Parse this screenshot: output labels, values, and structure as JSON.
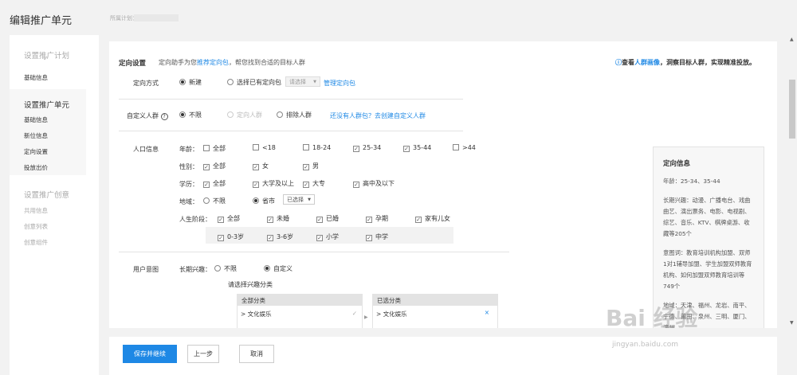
{
  "header": {
    "title": "编辑推广单元",
    "plan_label": "所属计划："
  },
  "sidebar": {
    "step1": {
      "title": "设置推广计划",
      "items": [
        "基础信息"
      ]
    },
    "step2": {
      "title": "设置推广单元",
      "items": [
        "基础信息",
        "新位信息",
        "定向设置",
        "投放出价"
      ]
    },
    "step3": {
      "title": "设置推广创意",
      "items": [
        "共用信息",
        "创意列表",
        "创意组件"
      ]
    }
  },
  "targeting": {
    "section_title": "定向设置",
    "hint_prefix": "定向助手为您",
    "hint_link": "推荐定向包",
    "hint_suffix": "，帮您找到合适的目标人群",
    "right_icon": "ⓘ",
    "right_prefix": "查看",
    "right_link": "人群画像",
    "right_suffix": "，洞察目标人群，实现精准投放。",
    "method": {
      "label": "定向方式",
      "opt_new": "新建",
      "opt_existing": "选择已有定向包",
      "select_placeholder": "请选择",
      "manage_link": "管理定向包"
    },
    "custom": {
      "label": "自定义人群",
      "help_icon": "?",
      "opt_unlimited": "不限",
      "opt_target": "定向人群",
      "opt_exclude": "排除人群",
      "tip_link": "还没有人群包？去创建自定义人群"
    },
    "demographics": {
      "label": "人口信息",
      "age": {
        "label": "年龄：",
        "options": [
          "全部",
          "<18",
          "18-24",
          "25-34",
          "35-44",
          ">44"
        ]
      },
      "gender": {
        "label": "性别：",
        "options": [
          "全部",
          "女",
          "男"
        ]
      },
      "education": {
        "label": "学历：",
        "options": [
          "全部",
          "大学及以上",
          "大专",
          "高中及以下"
        ]
      },
      "region": {
        "label": "地域：",
        "opt_unlimited": "不限",
        "opt_province": "省市",
        "select": "已选择"
      },
      "life_stage": {
        "label": "人生阶段：",
        "options": [
          "全部",
          "未婚",
          "已婚",
          "孕期",
          "家有儿女"
        ],
        "children": [
          "0-3岁",
          "3-6岁",
          "小学",
          "中学"
        ]
      }
    },
    "intent": {
      "label": "用户意图",
      "long_term_label": "长期兴趣：",
      "opt_unlimited": "不限",
      "opt_custom": "自定义",
      "choose_label": "请选择兴趣分类",
      "all_header": "全部分类",
      "selected_header": "已选分类",
      "all_first": "> 文化娱乐",
      "selected_first": "> 文化娱乐",
      "check_mark": "✓",
      "remove_mark": "×",
      "move_arrow": "▶"
    }
  },
  "summary": {
    "title": "定向信息",
    "age": "年龄：25-34、35-44",
    "interest": "长期兴趣：动漫、广播电台、戏曲曲艺、演出票务、电影、电视剧、综艺、音乐、KTV、棋牌桌游、收藏等205个",
    "intent": "意图词：教育培训机构加盟、双师1对1辅导加盟、学生加盟双师教育机构、如何加盟双师教育培训等749个",
    "region": "地域：天津、福州、龙岩、南平、宁德、莆田、泉州、三明、厦门、漳州…"
  },
  "footer": {
    "save": "保存并继续",
    "prev": "上一步",
    "cancel": "取消"
  },
  "watermark": {
    "logo": "Bai 经验",
    "url": "jingyan.baidu.com"
  }
}
